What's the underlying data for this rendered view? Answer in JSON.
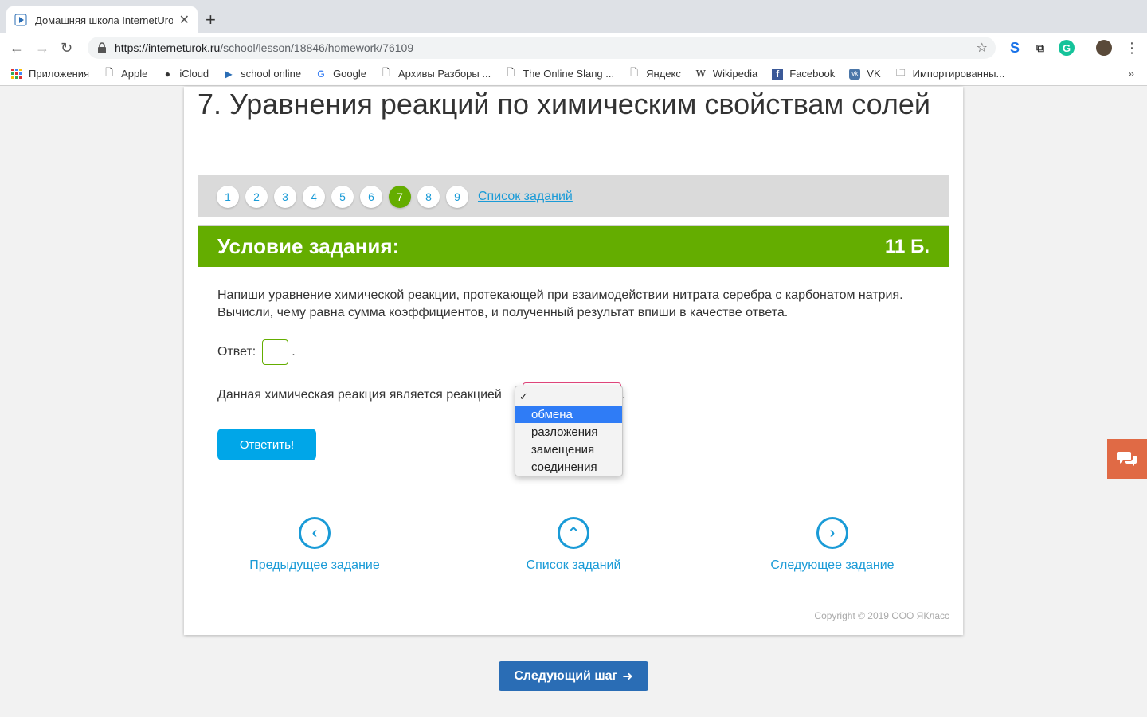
{
  "browser": {
    "tab_title": "Домашняя школа InternetUrok",
    "url_host": "https://interneturok.ru",
    "url_path": "/school/lesson/18846/homework/76109",
    "bookmarks": [
      "Приложения",
      "Apple",
      "iCloud",
      "school online",
      "Google",
      "Архивы Разборы ...",
      "The Online Slang ...",
      "Яндекс",
      "Wikipedia",
      "Facebook",
      "VK",
      "Импортированны..."
    ],
    "more": "»"
  },
  "lesson": {
    "title": "7. Уравнения реакций по химическим свойствам солей"
  },
  "pager": {
    "pages": [
      "1",
      "2",
      "3",
      "4",
      "5",
      "6",
      "7",
      "8",
      "9"
    ],
    "active": "7",
    "list_link": "Список заданий"
  },
  "task": {
    "header": "Условие задания:",
    "points": "11 Б.",
    "text": "Напиши уравнение химической реакции, протекающей при взаимодействии нитрата серебра с карбонатом натрия. Вычисли, чему равна сумма коэффициентов, и полученный результат впиши в качестве ответа.",
    "answer_label": "Ответ:",
    "answer_value": "",
    "reaction_label": "Данная химическая реакция является реакцией",
    "period": ".",
    "submit": "Ответить!"
  },
  "dropdown": {
    "check": "✓",
    "options": [
      "обмена",
      "разложения",
      "замещения",
      "соединения"
    ],
    "highlighted": "обмена"
  },
  "nav": {
    "prev": "Предыдущее задание",
    "list": "Список заданий",
    "next": "Следующее задание"
  },
  "footer": {
    "copyright": "Copyright © 2019 ООО ЯКласс",
    "next_step": "Следующий шаг"
  },
  "colors": {
    "green": "#64ad00",
    "blue_link": "#1a9bd7",
    "submit_blue": "#00a6e8",
    "dropdown_highlight": "#2f7cf6",
    "chat_orange": "#e06a45"
  }
}
